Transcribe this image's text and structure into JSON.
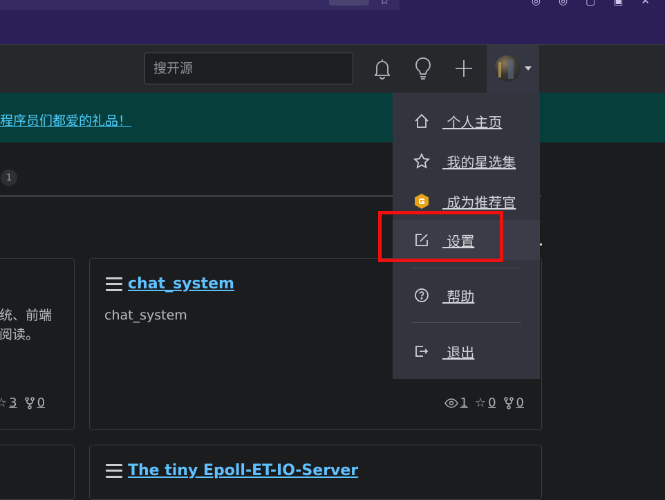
{
  "search": {
    "placeholder": "搜开源"
  },
  "banner": {
    "text": "程序员们都爱的礼品！"
  },
  "tabs": {
    "count": "1"
  },
  "dropdown": {
    "items": [
      {
        "label": " 个人主页",
        "icon": "home-icon"
      },
      {
        "label": " 我的星选集",
        "icon": "star-icon"
      },
      {
        "label": " 成为推荐官",
        "icon": "gitee-badge-icon"
      },
      {
        "label": " 设置",
        "icon": "edit-settings-icon"
      },
      {
        "label": " 帮助",
        "icon": "help-circle-icon"
      },
      {
        "label": " 退出",
        "icon": "logout-icon"
      }
    ]
  },
  "cards": {
    "left": {
      "desc_line1": "统、前端",
      "desc_line2": "阅读。",
      "stars": "3",
      "forks": "0"
    },
    "right": {
      "title": "chat_system",
      "description": "chat_system",
      "watches": "1",
      "stars": "0",
      "forks": "0"
    },
    "right2": {
      "title": "The tiny Epoll-ET-IO-Server"
    }
  },
  "colors": {
    "accent_link": "#5fc1ff",
    "banner_bg": "#063e3c",
    "highlight": "#f01010",
    "chrome_bg": "#2c1f57"
  }
}
